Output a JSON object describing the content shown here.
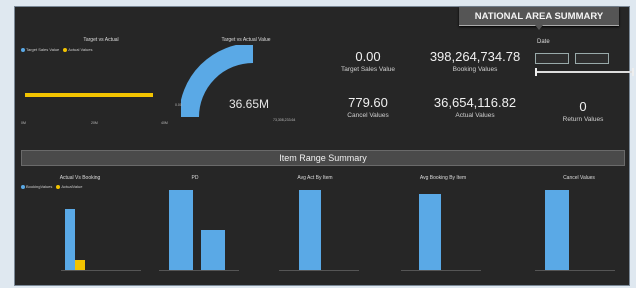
{
  "header": {
    "title": "NATIONAL AREA SUMMARY"
  },
  "target_vs_actual_bar": {
    "title": "Target vs Actual",
    "legend": [
      "Target Sales Value",
      "Actual Values"
    ],
    "ticks": [
      "0M",
      "20M",
      "40M"
    ],
    "colors": {
      "target": "#5aa9e6",
      "actual": "#f2c300"
    }
  },
  "gauge": {
    "title": "Target vs Actual Value",
    "value": "36.65M",
    "min_label": "0.00",
    "max_label": "73,308,233.64",
    "fill_fraction": 0.5
  },
  "kpis": {
    "target_sales": {
      "value": "0.00",
      "label": "Target Sales Value"
    },
    "booking": {
      "value": "398,264,734.78",
      "label": "Booking Values"
    },
    "cancel": {
      "value": "779.60",
      "label": "Cancel Values"
    },
    "actual": {
      "value": "36,654,116.82",
      "label": "Actual Values"
    },
    "return": {
      "value": "0",
      "label": "Return Values"
    }
  },
  "date_filter": {
    "label": "Date"
  },
  "section": {
    "title": "Item Range Summary"
  },
  "charts": {
    "actual_vs_booking": {
      "title": "Actual Vs Booking",
      "legend": [
        "BookingValues",
        "ActualValue"
      ]
    },
    "pd": {
      "title": "PD"
    },
    "avg_act_by_item": {
      "title": "Avg Act By Item"
    },
    "avg_booking_by_item": {
      "title": "Avg Booking By Item"
    },
    "cancel_values": {
      "title": "Cancel Values"
    }
  },
  "chart_data": [
    {
      "type": "bar",
      "title": "Actual Vs Booking",
      "series": [
        {
          "name": "BookingValues",
          "values": [
            0.76,
            0.0
          ]
        },
        {
          "name": "ActualValue",
          "values": [
            0.12,
            0.0
          ]
        }
      ],
      "ylim": [
        0,
        1.0
      ]
    },
    {
      "type": "bar",
      "title": "PD",
      "values": [
        1.0,
        0.5
      ]
    },
    {
      "type": "bar",
      "title": "Avg Act By Item",
      "values": [
        1.0,
        0.0
      ]
    },
    {
      "type": "bar",
      "title": "Avg Booking By Item",
      "values": [
        0.95,
        0.0
      ]
    },
    {
      "type": "bar",
      "title": "Cancel Values",
      "values": [
        1.0,
        0.0
      ]
    }
  ]
}
